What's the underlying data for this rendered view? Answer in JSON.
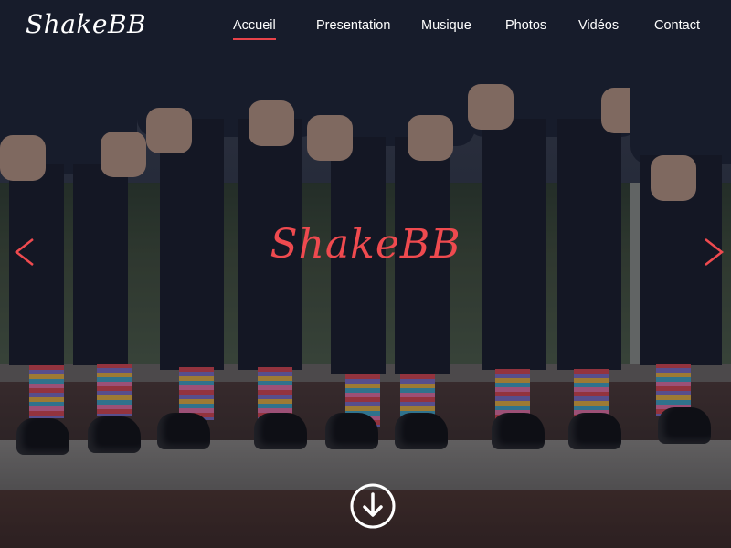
{
  "header": {
    "logo": "ShakeBB",
    "nav": [
      {
        "label": "Accueil",
        "active": true
      },
      {
        "label": "Presentation",
        "active": false
      },
      {
        "label": "Musique",
        "active": false
      },
      {
        "label": "Photos",
        "active": false
      },
      {
        "label": "Vidéos",
        "active": false
      },
      {
        "label": "Contact",
        "active": false
      }
    ]
  },
  "hero": {
    "title": "ShakeBB",
    "prev_icon": "chevron-left-icon",
    "next_icon": "chevron-right-icon",
    "scroll_icon": "arrow-down-circle-icon"
  },
  "colors": {
    "accent": "#ef4a4f",
    "nav_text": "#ffffff"
  }
}
